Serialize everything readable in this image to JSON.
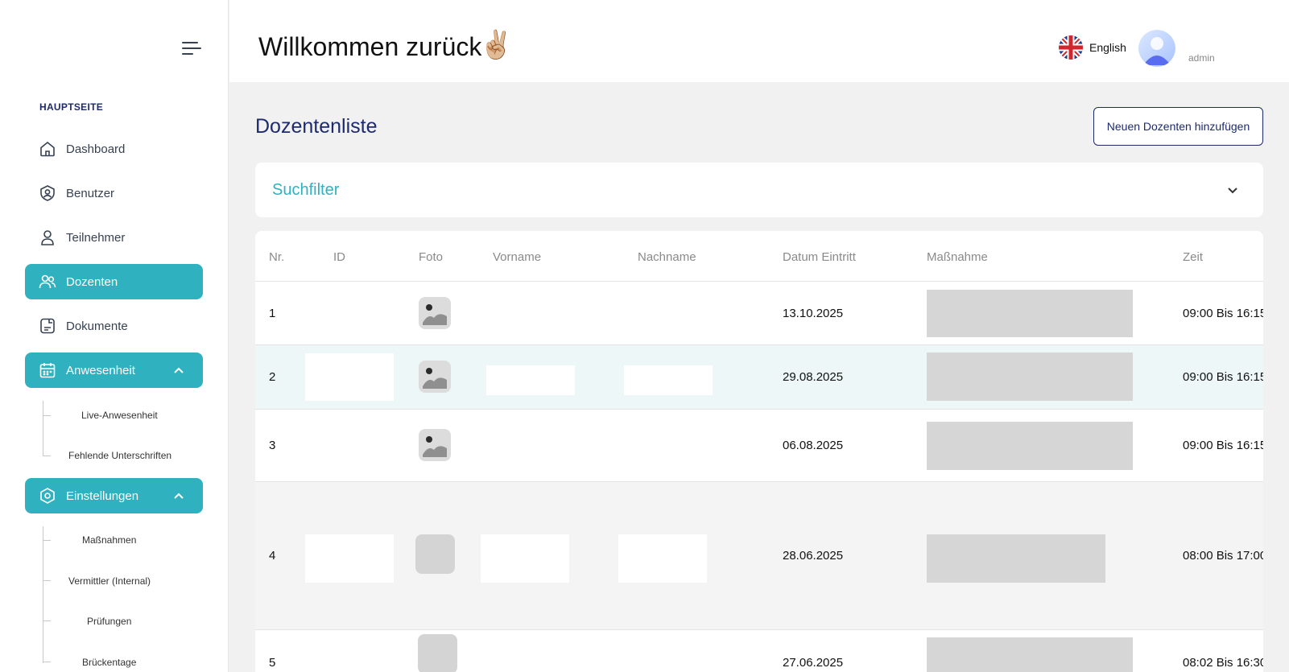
{
  "header": {
    "welcome": "Willkommen zurück",
    "greeting_emoji": "✌🏼",
    "language_label": "English",
    "username": "admin"
  },
  "sidebar": {
    "section_title": "HAUPTSEITE",
    "items": [
      {
        "label": "Dashboard",
        "icon": "home-icon"
      },
      {
        "label": "Benutzer",
        "icon": "user-shield-icon"
      },
      {
        "label": "Teilnehmer",
        "icon": "person-icon"
      },
      {
        "label": "Dozenten",
        "icon": "users-icon",
        "active": true
      },
      {
        "label": "Dokumente",
        "icon": "document-icon"
      },
      {
        "label": "Anwesenheit",
        "icon": "calendar-icon",
        "expanded": true
      },
      {
        "label": "Einstellungen",
        "icon": "settings-icon",
        "expanded": true
      }
    ],
    "anwesenheit_sub": [
      "Live-Anwesenheit",
      "Fehlende Unterschriften"
    ],
    "einstellungen_sub": [
      "Maßnahmen",
      "Vermittler (Internal)",
      "Prüfungen",
      "Brückentage"
    ]
  },
  "main": {
    "page_title": "Dozentenliste",
    "add_button": "Neuen Dozenten hinzufügen",
    "filter_title": "Suchfilter"
  },
  "table": {
    "headers": [
      "Nr.",
      "ID",
      "Foto",
      "Vorname",
      "Nachname",
      "Datum Eintritt",
      "Maßnahme",
      "Zeit"
    ],
    "rows": [
      {
        "nr": "1",
        "date": "13.10.2025",
        "time": "09:00 Bis 16:15"
      },
      {
        "nr": "2",
        "date": "29.08.2025",
        "time": "09:00 Bis 16:15"
      },
      {
        "nr": "3",
        "date": "06.08.2025",
        "time": "09:00 Bis 16:15"
      },
      {
        "nr": "4",
        "date": "28.06.2025",
        "time": "08:00 Bis 17:00"
      },
      {
        "nr": "5",
        "date": "27.06.2025",
        "time": "08:02 Bis 16:30"
      }
    ]
  },
  "colors": {
    "accent": "#2fb1bf",
    "navy": "#1e2a6e",
    "row_highlight": "#eef7f7"
  }
}
